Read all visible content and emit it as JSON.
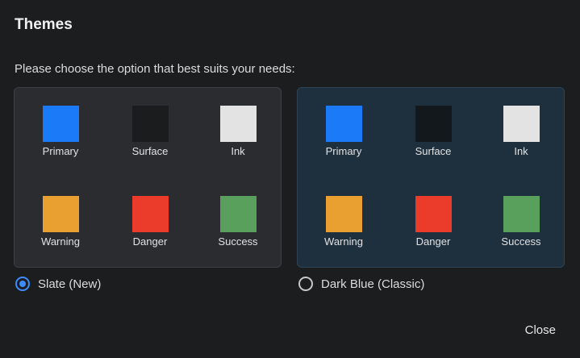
{
  "dialog": {
    "title": "Themes",
    "prompt": "Please choose the option that best suits your needs:",
    "close_label": "Close"
  },
  "themes": [
    {
      "name": "Slate (New)",
      "selected": true,
      "swatches": [
        {
          "label": "Primary",
          "color": "#1a7af8"
        },
        {
          "label": "Surface",
          "color": "#1b1c1e"
        },
        {
          "label": "Ink",
          "color": "#e3e3e3"
        },
        {
          "label": "Warning",
          "color": "#e9a030"
        },
        {
          "label": "Danger",
          "color": "#eb3b2b"
        },
        {
          "label": "Success",
          "color": "#58a05c"
        }
      ]
    },
    {
      "name": "Dark Blue (Classic)",
      "selected": false,
      "swatches": [
        {
          "label": "Primary",
          "color": "#1a7af8"
        },
        {
          "label": "Surface",
          "color": "#13181d"
        },
        {
          "label": "Ink",
          "color": "#e3e3e3"
        },
        {
          "label": "Warning",
          "color": "#e9a030"
        },
        {
          "label": "Danger",
          "color": "#eb3b2b"
        },
        {
          "label": "Success",
          "color": "#58a05c"
        }
      ]
    }
  ]
}
